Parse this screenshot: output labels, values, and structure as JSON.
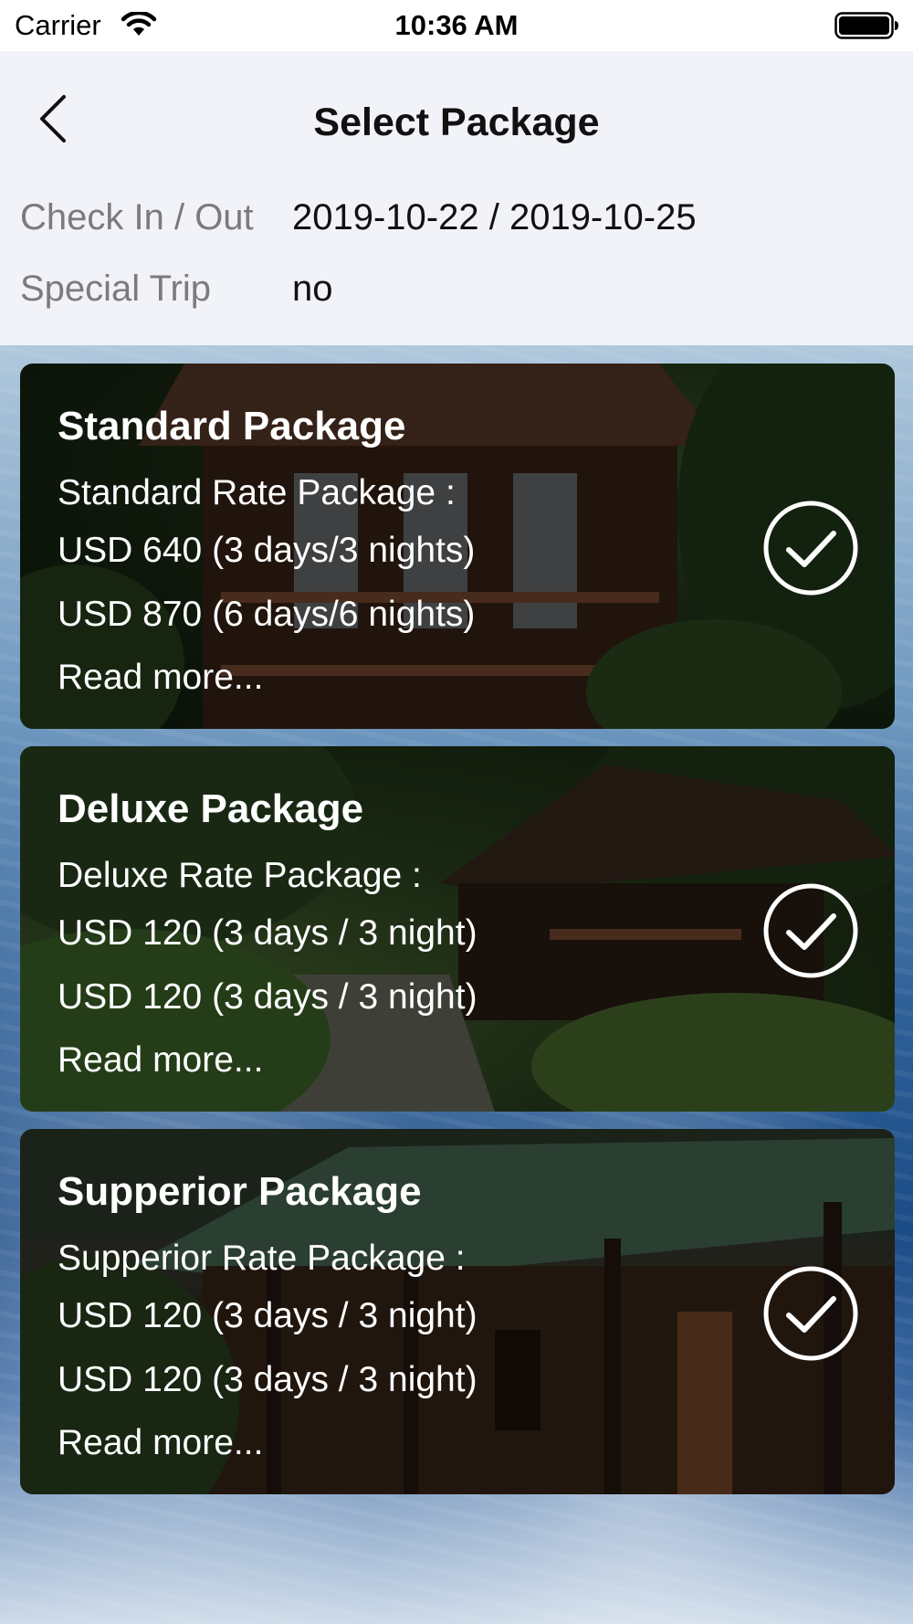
{
  "status_bar": {
    "carrier": "Carrier",
    "time": "10:36 AM"
  },
  "header": {
    "title": "Select Package",
    "check_in_out_label": "Check In / Out",
    "check_in_out_value": "2019-10-22 / 2019-10-25",
    "special_trip_label": "Special Trip",
    "special_trip_value": "no"
  },
  "packages": [
    {
      "title": "Standard Package",
      "rate_label": "Standard Rate Package :",
      "rates": [
        "USD 640 (3 days/3 nights)",
        "USD 870 (6 days/6 nights)"
      ],
      "read_more": "Read more...",
      "selected_icon": "check-circle-icon"
    },
    {
      "title": "Deluxe Package",
      "rate_label": "Deluxe Rate Package :",
      "rates": [
        "USD 120 (3 days / 3 night)",
        "USD 120 (3 days / 3 night)"
      ],
      "read_more": "Read more...",
      "selected_icon": "check-circle-icon"
    },
    {
      "title": "Supperior Package",
      "rate_label": "Supperior Rate Package :",
      "rates": [
        "USD 120 (3 days / 3 night)",
        "USD 120 (3 days / 3 night)"
      ],
      "read_more": "Read more...",
      "selected_icon": "check-circle-icon"
    }
  ],
  "colors": {
    "header_bg": "#f1f3f8",
    "label_gray": "#7b7b7b",
    "card_text": "#ffffff"
  }
}
